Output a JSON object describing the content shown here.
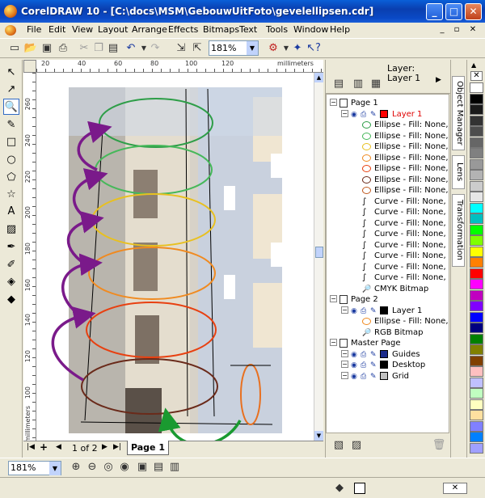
{
  "window": {
    "title": "CorelDRAW 10 - [C:\\docs\\MSM\\GebouwUitFoto\\gevelellipsen.cdr]",
    "minimize": "_",
    "maximize": "□",
    "close": "✕"
  },
  "menu": {
    "items": [
      "File",
      "Edit",
      "View",
      "Layout",
      "Arrange",
      "Effects",
      "Bitmaps",
      "Text",
      "Tools",
      "Window",
      "Help"
    ],
    "doc_min": "_",
    "doc_restore": "▫",
    "doc_close": "✕"
  },
  "toolbar": {
    "zoom_value": "181%",
    "icons": [
      "new-icon",
      "open-icon",
      "save-icon",
      "print-icon",
      "cut-icon",
      "copy-icon",
      "paste-icon",
      "undo-icon",
      "redo-icon",
      "import-icon",
      "export-icon",
      "zoom-level",
      "application-launcher-icon",
      "corel-online-icon",
      "whats-this-icon"
    ]
  },
  "ruler": {
    "unit": "millimeters",
    "h_ticks": [
      "20",
      "40",
      "60",
      "80",
      "100",
      "120"
    ],
    "v_ticks": [
      "260",
      "240",
      "220",
      "200",
      "180",
      "160",
      "140",
      "120",
      "100"
    ],
    "v_unit": "millimeters"
  },
  "pages": {
    "count_label": "1 of 2",
    "active_tab": "Page 1"
  },
  "docker": {
    "layer_label": "Layer:",
    "layer_value": "Layer 1",
    "tree": [
      {
        "indent": 0,
        "type": "page",
        "label": "Page 1"
      },
      {
        "indent": 1,
        "type": "layer",
        "label": "Layer 1",
        "color": "#ff0000",
        "highlight": true
      },
      {
        "indent": 2,
        "type": "ellipse",
        "label": "Ellipse - Fill: None, C",
        "color": "#2e9e48"
      },
      {
        "indent": 2,
        "type": "ellipse",
        "label": "Ellipse - Fill: None, C",
        "color": "#46b85a"
      },
      {
        "indent": 2,
        "type": "ellipse",
        "label": "Ellipse - Fill: None, C",
        "color": "#e8c020"
      },
      {
        "indent": 2,
        "type": "ellipse",
        "label": "Ellipse - Fill: None, C",
        "color": "#f08a20"
      },
      {
        "indent": 2,
        "type": "ellipse",
        "label": "Ellipse - Fill: None, C",
        "color": "#e84010"
      },
      {
        "indent": 2,
        "type": "ellipse",
        "label": "Ellipse - Fill: None, C",
        "color": "#6a2a1a"
      },
      {
        "indent": 2,
        "type": "ellipse",
        "label": "Ellipse - Fill: None, C",
        "color": "#c05a20"
      },
      {
        "indent": 2,
        "type": "curve",
        "label": "Curve - Fill: None, C"
      },
      {
        "indent": 2,
        "type": "curve",
        "label": "Curve - Fill: None, C"
      },
      {
        "indent": 2,
        "type": "curve",
        "label": "Curve - Fill: None, C"
      },
      {
        "indent": 2,
        "type": "curve",
        "label": "Curve - Fill: None, C"
      },
      {
        "indent": 2,
        "type": "curve",
        "label": "Curve - Fill: None, C"
      },
      {
        "indent": 2,
        "type": "curve",
        "label": "Curve - Fill: None, C"
      },
      {
        "indent": 2,
        "type": "curve",
        "label": "Curve - Fill: None, C"
      },
      {
        "indent": 2,
        "type": "curve",
        "label": "Curve - Fill: None, C"
      },
      {
        "indent": 2,
        "type": "bitmap",
        "label": "CMYK Bitmap"
      },
      {
        "indent": 0,
        "type": "page",
        "label": "Page 2"
      },
      {
        "indent": 1,
        "type": "layer",
        "label": "Layer 1",
        "color": "#000000"
      },
      {
        "indent": 2,
        "type": "ellipse",
        "label": "Ellipse - Fill: None, C",
        "color": "#f08a20"
      },
      {
        "indent": 2,
        "type": "bitmap",
        "label": "RGB Bitmap"
      },
      {
        "indent": 0,
        "type": "page",
        "label": "Master Page"
      },
      {
        "indent": 1,
        "type": "layer",
        "label": "Guides",
        "color": "#1a2a8a"
      },
      {
        "indent": 1,
        "type": "layer",
        "label": "Desktop",
        "color": "#000000"
      },
      {
        "indent": 1,
        "type": "layer",
        "label": "Grid",
        "color": "#c0c0c0"
      }
    ]
  },
  "side_tabs": [
    "Object Manager",
    "Lens",
    "Transformation"
  ],
  "palette": [
    "#ffffff",
    "#000000",
    "#1a1a1a",
    "#333333",
    "#4d4d4d",
    "#666666",
    "#808080",
    "#999999",
    "#b3b3b3",
    "#cccccc",
    "#e6e6e6",
    "#00ffff",
    "#00c0c0",
    "#00ff00",
    "#80ff00",
    "#ffff00",
    "#ff8000",
    "#ff0000",
    "#ff00ff",
    "#c000c0",
    "#8000ff",
    "#0000ff",
    "#000080",
    "#008000",
    "#808000",
    "#804000",
    "#ffc0c0",
    "#c0c0ff",
    "#c0ffc0",
    "#ffffc0",
    "#ffe0a0",
    "#8080ff",
    "#0080ff",
    "#a0a0ff"
  ],
  "status": {
    "zoom_value": "181%"
  },
  "colors": {
    "ellipse_1": "#2e9e48",
    "ellipse_2": "#46b85a",
    "ellipse_3": "#e8c020",
    "ellipse_4": "#f08a20",
    "ellipse_5": "#e84010",
    "ellipse_6": "#6a2a1a",
    "ellipse_small": "#e87020",
    "arrows_purple": "#7a1a8a",
    "arrow_green": "#1a9a30"
  }
}
